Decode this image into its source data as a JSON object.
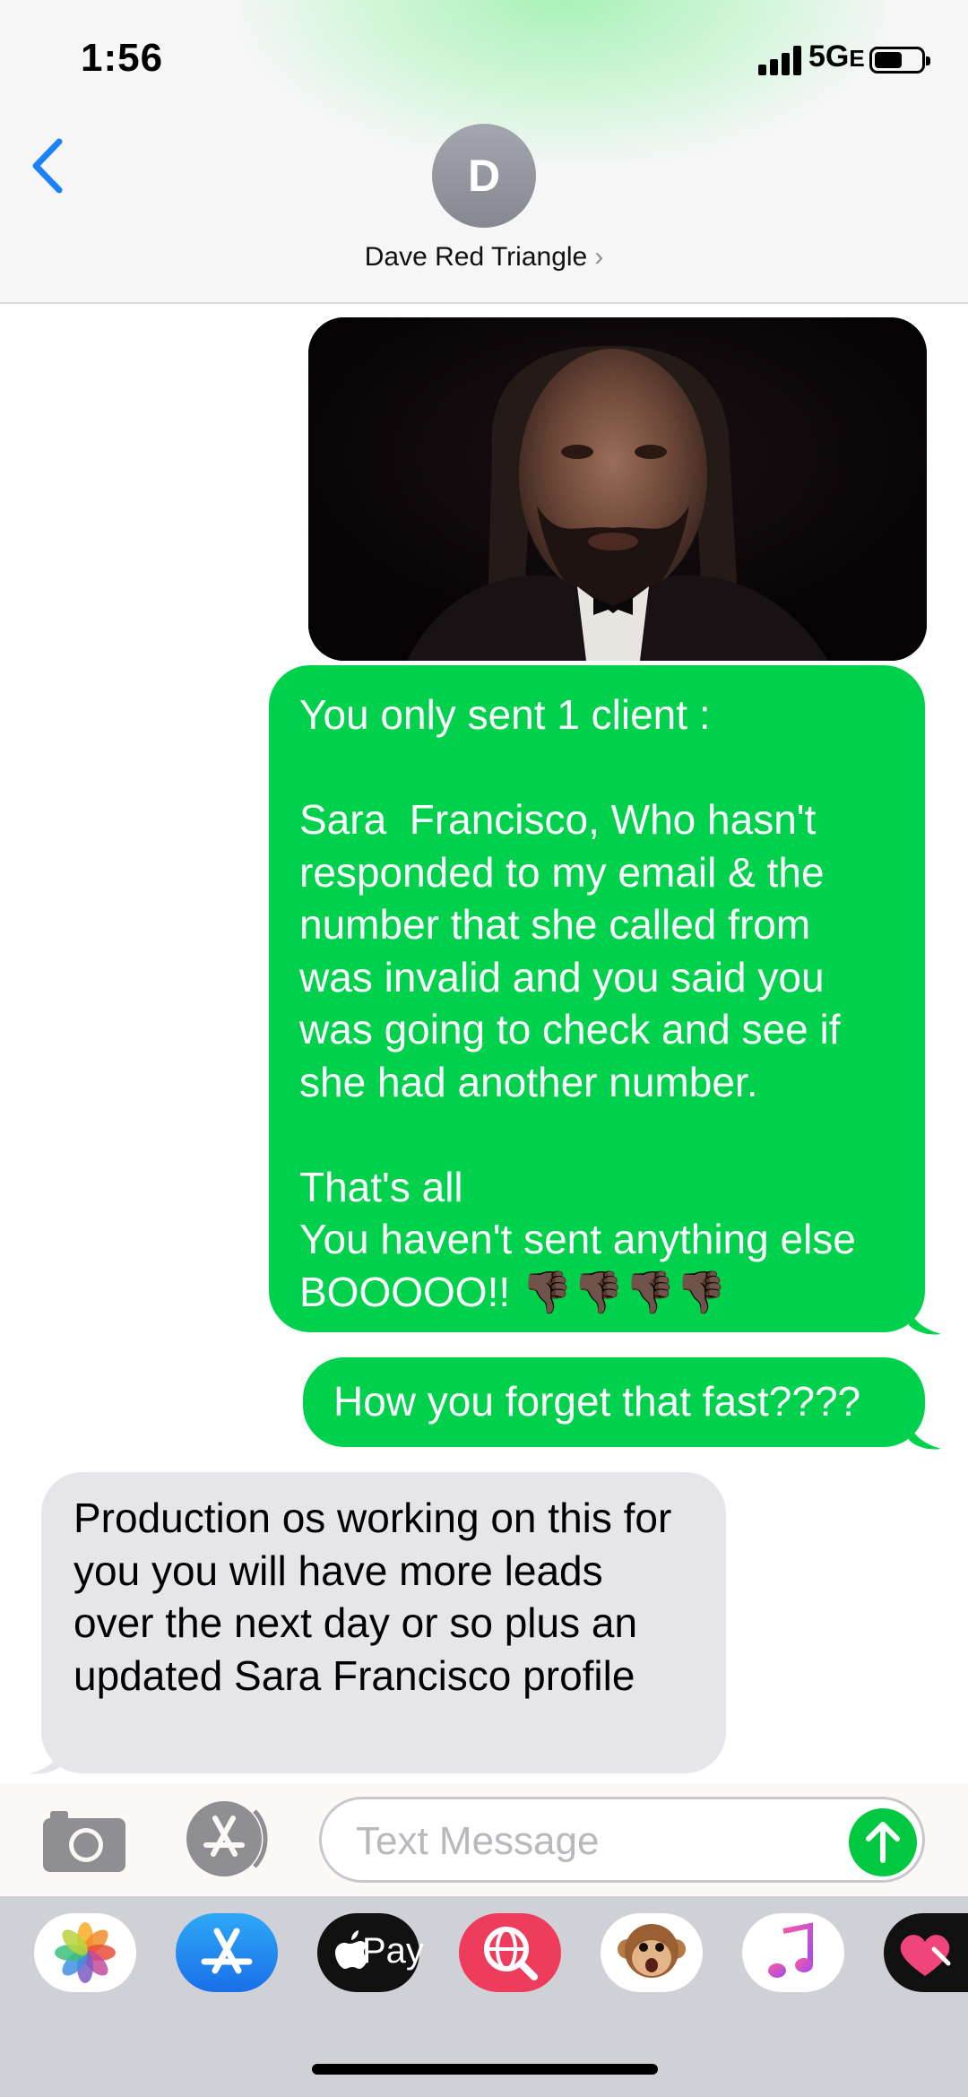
{
  "status_bar": {
    "time": "1:56",
    "network": "5G",
    "network_suffix": "E"
  },
  "header": {
    "avatar_initial": "D",
    "contact_name": "Dave Red Triangle",
    "chevron": "›"
  },
  "messages": [
    {
      "type": "gif",
      "direction": "outgoing"
    },
    {
      "type": "text",
      "direction": "outgoing",
      "text": "You only sent 1 client :\n\nSara  Francisco, Who hasn't responded to my email & the number that she called from was invalid and you said you was going to check and see if she had another number.\n\nThat's all\nYou haven't sent anything else BOOOOO!! 👎🏿👎🏿👎🏿👎🏿"
    },
    {
      "type": "text",
      "direction": "outgoing",
      "text": "How you forget that fast????"
    },
    {
      "type": "text",
      "direction": "incoming",
      "text": "Production os working on this for you you will have more leads over the next day or so plus an updated Sara Francisco profile"
    }
  ],
  "composer": {
    "placeholder": "Text Message"
  },
  "app_drawer": [
    {
      "icon": "photos-icon"
    },
    {
      "icon": "app-store-icon"
    },
    {
      "icon": "apple-pay-icon",
      "label": "Pay"
    },
    {
      "icon": "web-search-icon"
    },
    {
      "icon": "animoji-monkey-icon"
    },
    {
      "icon": "music-icon"
    },
    {
      "icon": "heart-app-icon"
    }
  ],
  "colors": {
    "outgoing_bubble": "#00d14d",
    "incoming_bubble": "#e5e5ea",
    "accent_blue": "#1a82fb"
  }
}
